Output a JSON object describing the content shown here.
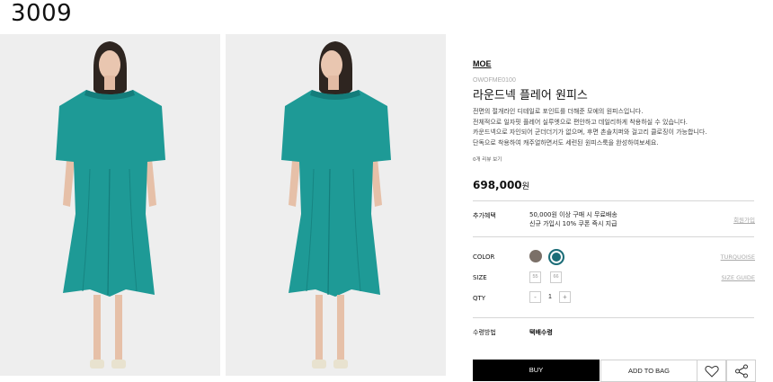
{
  "page_number": "3009",
  "product": {
    "brand": "MOE",
    "code": "OWOFME0100",
    "title": "라운드넥 플레어 원피스",
    "description": [
      "전면의 절개라인 디테일로 포인트를 더해준 모에의 원피스입니다.",
      "전체적으로 일자핏 플레어 실루엣으로 편안하고 데일리하게 착용하실 수 있습니다.",
      "카운드넥으로 자인되어 군더더기가 없으며, 후면 촌솔치퍼와 걸고리 클로징이 가능합니다.",
      "단독으로 착용하여 캐주얼하면서도 세련된 원피스룩을 완성하여보세요."
    ],
    "review_link": "0개 리뷰 보기",
    "price": "698,000",
    "currency": "원"
  },
  "benefits": {
    "label": "추가혜택",
    "lines": [
      "50,000원 이상 구매 시 무료배송",
      "신규 가입시 10% 쿠폰 즉시 지급"
    ],
    "link": "회원가입"
  },
  "options": {
    "color_label": "COLOR",
    "colors": [
      "#7b7068",
      "#1c6d78"
    ],
    "color_selected": "TURQUOISE",
    "size_label": "SIZE",
    "sizes": [
      "55",
      "66"
    ],
    "size_guide": "SIZE GUIDE",
    "qty_label": "QTY",
    "qty_minus": "-",
    "qty_value": "1",
    "qty_plus": "+"
  },
  "shipping": {
    "label": "수령방법",
    "value": "택배수령"
  },
  "actions": {
    "buy": "BUY",
    "add_to_bag": "ADD TO BAG",
    "wishlist_icon": "heart-icon",
    "share_icon": "share-icon"
  },
  "colors": {
    "dress": "#1e9a96",
    "dress_shadow": "#147d7b",
    "background": "#eeeeee",
    "buy_bg": "#000000"
  }
}
